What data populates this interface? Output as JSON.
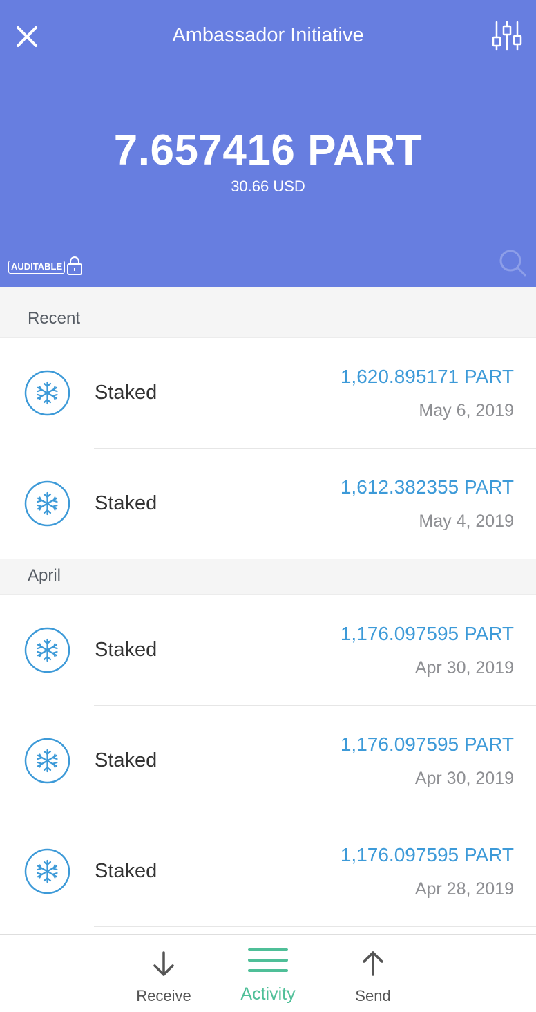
{
  "header": {
    "title": "Ambassador Initiative",
    "balance": "7.657416 PART",
    "fiat_balance": "30.66 USD",
    "auditable_badge": "AUDITABLE",
    "background_color": "#677ee0"
  },
  "icons": {
    "close": "close-icon",
    "filter": "sliders-icon",
    "lock": "lock-icon",
    "search": "search-icon",
    "staked": "snowflake-icon"
  },
  "sections": [
    {
      "title": "Recent",
      "transactions": [
        {
          "label": "Staked",
          "amount": "1,620.895171 PART",
          "date": "May 6, 2019"
        },
        {
          "label": "Staked",
          "amount": "1,612.382355 PART",
          "date": "May 4, 2019"
        }
      ]
    },
    {
      "title": "April",
      "transactions": [
        {
          "label": "Staked",
          "amount": "1,176.097595 PART",
          "date": "Apr 30, 2019"
        },
        {
          "label": "Staked",
          "amount": "1,176.097595 PART",
          "date": "Apr 30, 2019"
        },
        {
          "label": "Staked",
          "amount": "1,176.097595 PART",
          "date": "Apr 28, 2019"
        }
      ]
    }
  ],
  "tabs": {
    "receive": "Receive",
    "activity": "Activity",
    "send": "Send",
    "active": "activity",
    "active_color": "#4fbf98",
    "amount_color": "#3d9ad8"
  }
}
